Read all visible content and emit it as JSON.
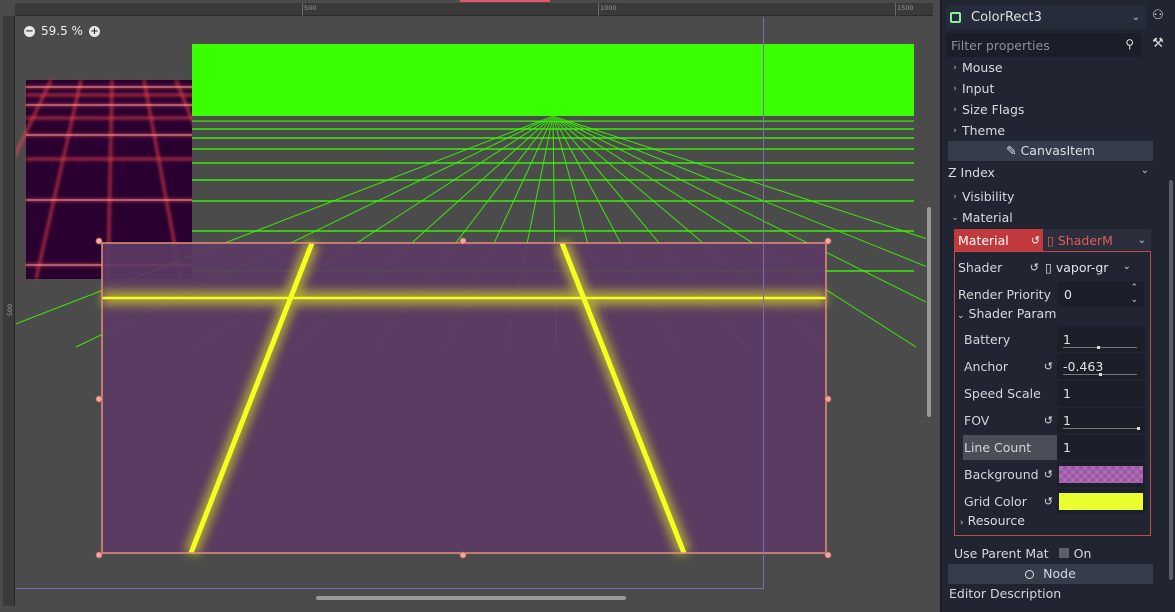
{
  "viewport": {
    "zoom_label": "59.5 %",
    "ruler_top_labels": [
      "500",
      "1000",
      "1500"
    ],
    "ruler_left_labels": [
      "500"
    ]
  },
  "inspector": {
    "node_name": "ColorRect3",
    "filter_placeholder": "Filter properties",
    "groups_top": [
      "Mouse",
      "Input",
      "Size Flags",
      "Theme"
    ],
    "canvasitem_section": "CanvasItem",
    "z_index_label": "Z Index",
    "visibility_label": "Visibility",
    "material_group_label": "Material",
    "material": {
      "label": "Material",
      "value": "ShaderM",
      "shader_label": "Shader",
      "shader_value": "vapor-gr",
      "render_priority_label": "Render Priority",
      "render_priority_value": "0",
      "shader_param_label": "Shader Param",
      "params": [
        {
          "label": "Battery",
          "value": "1"
        },
        {
          "label": "Anchor",
          "value": "-0.463"
        },
        {
          "label": "Speed Scale",
          "value": "1"
        },
        {
          "label": "FOV",
          "value": "1"
        },
        {
          "label": "Line Count",
          "value": "1"
        },
        {
          "label": "Background",
          "value": ""
        },
        {
          "label": "Grid Color",
          "value": ""
        }
      ],
      "resource_label": "Resource"
    },
    "use_parent_label": "Use Parent Mat",
    "use_parent_value": "On",
    "node_section": "Node",
    "editor_description": "Editor Description"
  },
  "colors": {
    "accent_red": "#c2393d",
    "background_swatch": "#b06bb8",
    "grid_color_swatch": "#e9ff2f",
    "green_grid": "#3cff00",
    "red_grid": "#ff3b3b",
    "selected_rect_fill": "#5b3a63"
  }
}
